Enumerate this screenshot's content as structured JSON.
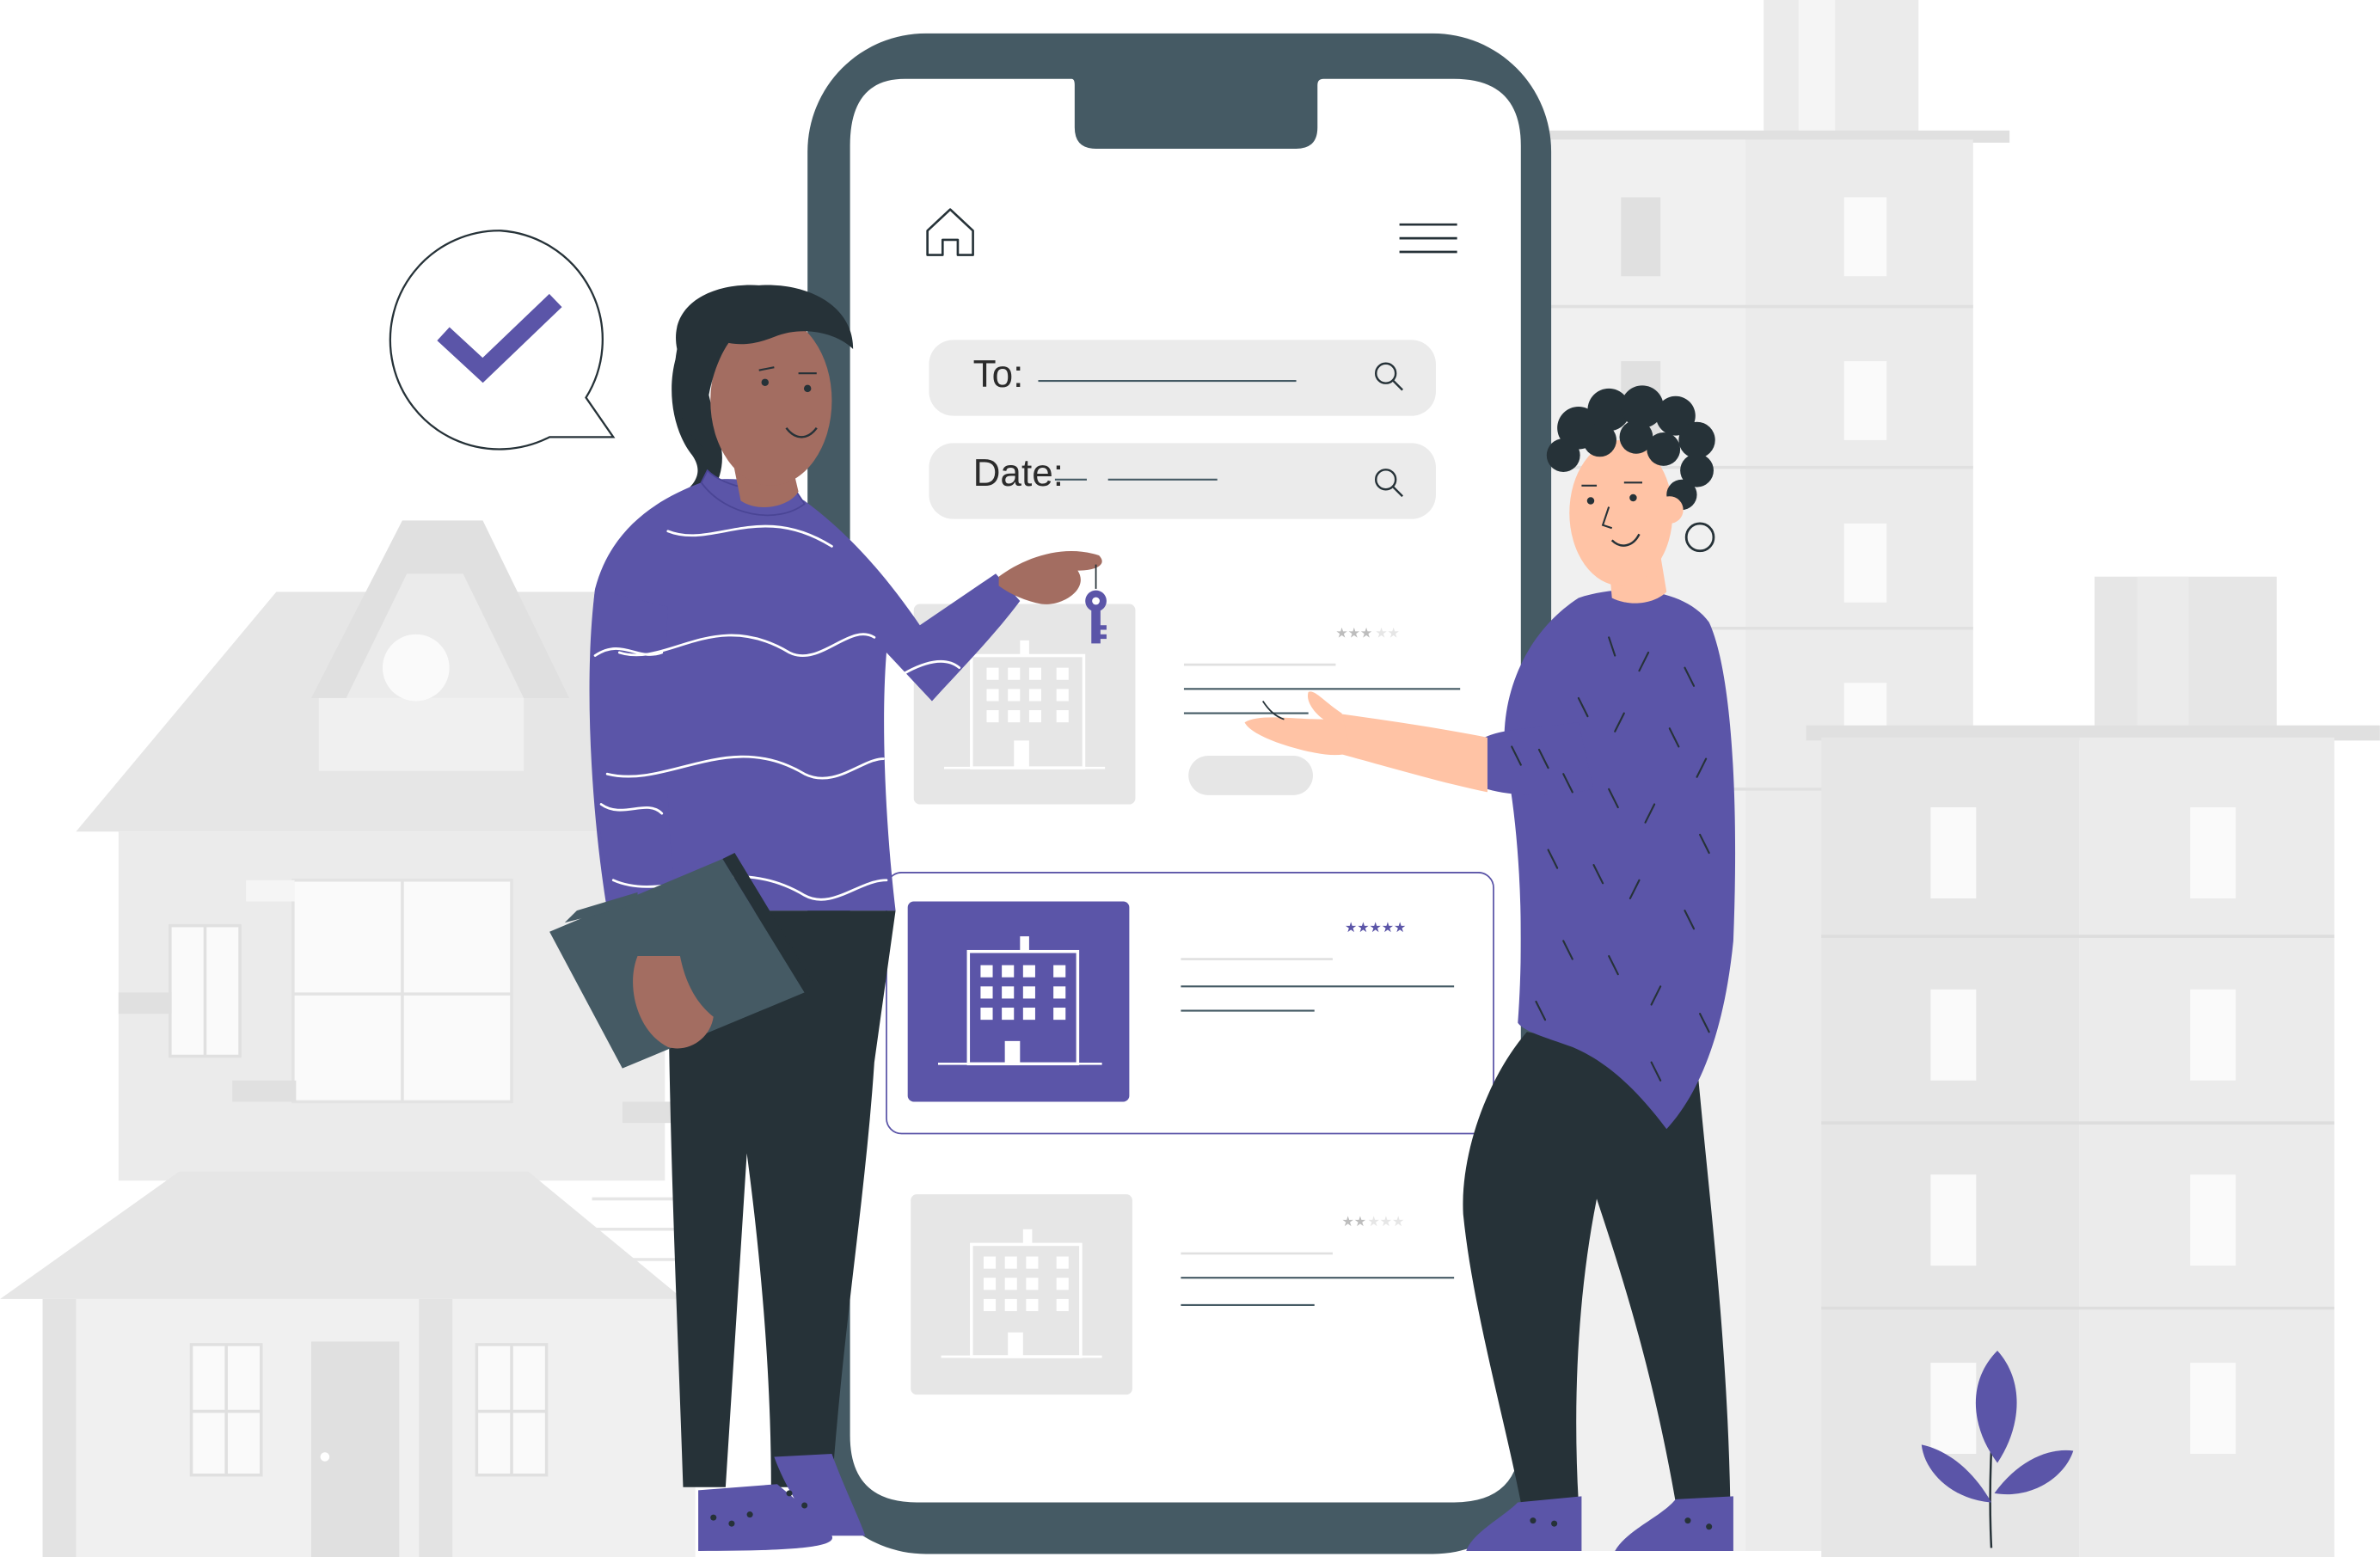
{
  "search": {
    "to_label": "To:",
    "date_label": "Date:"
  },
  "listings": [
    {
      "rating": 3,
      "max_rating": 5,
      "state": "default"
    },
    {
      "rating": 5,
      "max_rating": 5,
      "state": "selected"
    },
    {
      "rating": 2,
      "max_rating": 5,
      "state": "default"
    }
  ],
  "icons": {
    "nav_home": "home-icon",
    "nav_menu": "hamburger-menu-icon",
    "search": "magnifier-icon",
    "confirm": "checkmark-icon",
    "key": "key-icon",
    "building": "building-icon"
  },
  "colors": {
    "accent": "#5b55a8",
    "phone_frame": "#455a64",
    "dark": "#263238",
    "skin_dark": "#a36d61",
    "skin_light": "#ffc3a5",
    "field_bg": "#ebebeb",
    "background_shapes": "#ebebeb"
  }
}
